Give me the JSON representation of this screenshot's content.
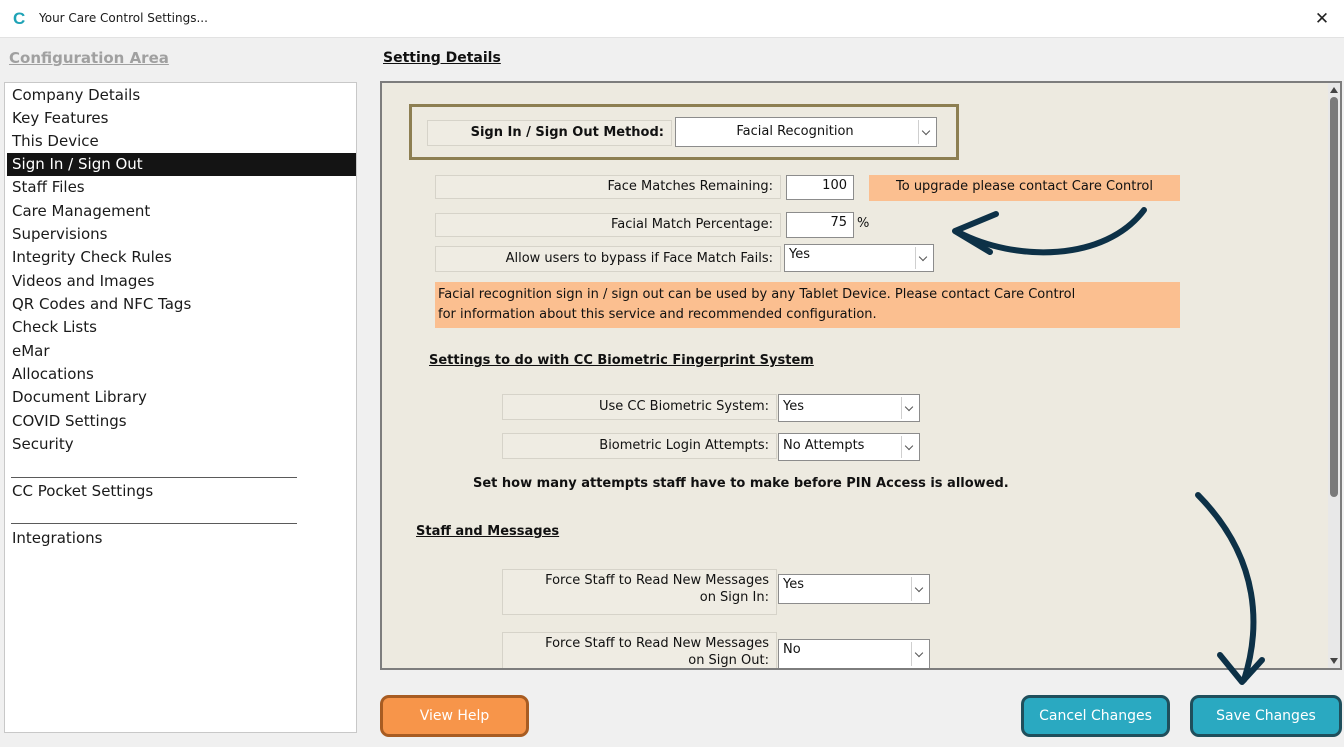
{
  "window": {
    "logo": "C",
    "title": "Your Care Control Settings...",
    "close_glyph": "✕"
  },
  "left": {
    "header": "Configuration Area",
    "items": [
      {
        "label": "Company Details"
      },
      {
        "label": "Key Features"
      },
      {
        "label": "This Device"
      },
      {
        "label": "Sign In / Sign Out",
        "selected": true
      },
      {
        "label": "Staff Files"
      },
      {
        "label": "Care Management"
      },
      {
        "label": "Supervisions"
      },
      {
        "label": "Integrity Check Rules"
      },
      {
        "label": "Videos and Images"
      },
      {
        "label": "QR Codes and NFC Tags"
      },
      {
        "label": "Check Lists"
      },
      {
        "label": "eMar"
      },
      {
        "label": "Allocations"
      },
      {
        "label": "Document Library"
      },
      {
        "label": "COVID Settings"
      },
      {
        "label": "Security"
      }
    ],
    "pocket": "CC Pocket Settings",
    "integrations": "Integrations"
  },
  "right": {
    "header": "Setting Details",
    "method": {
      "label": "Sign In / Sign Out Method:",
      "value": "Facial Recognition"
    },
    "face_matches": {
      "label": "Face Matches Remaining:",
      "value": "100",
      "notice": "To upgrade please contact Care Control"
    },
    "match_pct": {
      "label": "Facial Match Percentage:",
      "value": "75",
      "unit": "%"
    },
    "bypass": {
      "label": "Allow users to bypass if Face Match Fails:",
      "value": "Yes"
    },
    "info": {
      "line1": "Facial recognition sign in / sign out can be used by any Tablet Device.  Please contact Care Control",
      "line2": "for information about this service and recommended configuration."
    },
    "biometric": {
      "heading": "Settings to do with CC Biometric Fingerprint System",
      "use": {
        "label": "Use CC Biometric System:",
        "value": "Yes"
      },
      "attempts": {
        "label": "Biometric Login Attempts:",
        "value": "No Attempts"
      },
      "note": "Set how many attempts staff have to make before PIN Access is allowed."
    },
    "messages": {
      "heading": "Staff and Messages",
      "sign_in": {
        "label_line1": "Force Staff to Read New Messages",
        "label_line2": "on Sign In:",
        "value": "Yes"
      },
      "sign_out": {
        "label_line1": "Force Staff to Read New Messages",
        "label_line2": "on Sign Out:",
        "value": "No"
      }
    }
  },
  "buttons": {
    "help": "View Help",
    "cancel": "Cancel Changes",
    "save": "Save Changes"
  },
  "colors": {
    "accent": "#2aa9c1",
    "help": "#f7954a",
    "notice": "#fbbf90",
    "panel": "#edeae0",
    "frame": "#8d7f52",
    "arrow": "#0d3147"
  }
}
